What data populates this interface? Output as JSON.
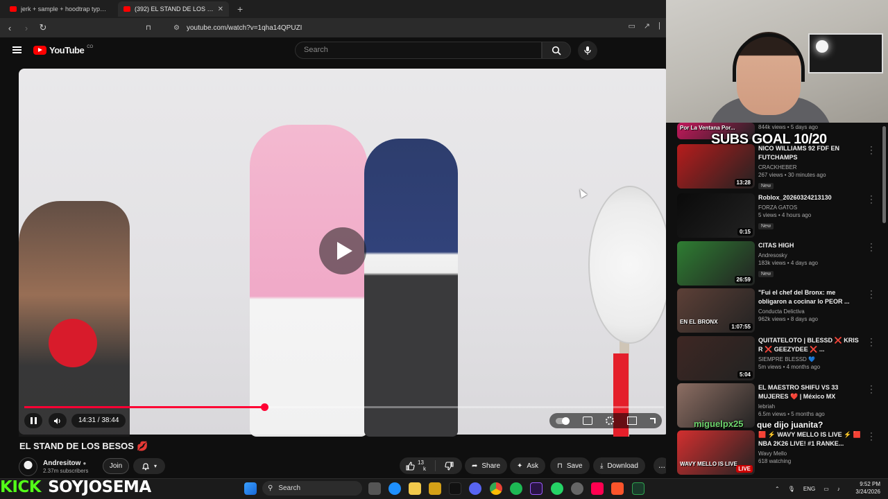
{
  "browser": {
    "tabs": [
      {
        "label": "jerk + sample + hoodtrap type beat",
        "active": false
      },
      {
        "label": "(392) EL STAND DE LOS BESOS",
        "active": true
      }
    ],
    "new_tab": "+",
    "url": "youtube.com/watch?v=1qha14QPUZI"
  },
  "youtube": {
    "logo_text": "YouTube",
    "country_code": "CO",
    "search_placeholder": "Search"
  },
  "player": {
    "time": "14:31 / 38:44",
    "progress_fraction": 0.375,
    "accent": "#ff0033"
  },
  "video": {
    "title": "EL STAND DE LOS BESOS",
    "title_emoji": "💋",
    "channel_name": "Andresitow",
    "subscribers": "2.37m subscribers",
    "join_label": "Join",
    "like_count": "13",
    "like_suffix": "k",
    "share_label": "Share",
    "ask_label": "Ask",
    "save_label": "Save",
    "download_label": "Download",
    "more_label": "..."
  },
  "sidebar": {
    "items": [
      {
        "title": "",
        "channel": "",
        "meta": "844k views • 5 days ago",
        "duration": "",
        "new": false,
        "thumb": "#c2185b",
        "thumb_text": "Por La Ventana Por..."
      },
      {
        "title": "NICO WILLIAMS 92 FDF EN FUTCHAMPS",
        "channel": "CRACKHEBER",
        "meta": "267 views • 30 minutes ago",
        "duration": "13:28",
        "new": true,
        "thumb": "#b71c1c"
      },
      {
        "title": "Roblox_20260324213130",
        "channel": "FORZA GATOS",
        "meta": "5 views • 4 hours ago",
        "duration": "0:15",
        "new": true,
        "thumb": "#0a0a0a"
      },
      {
        "title": "CITAS HIGH",
        "channel": "Andresosky",
        "meta": "183k views • 4 days ago",
        "duration": "26:59",
        "new": true,
        "thumb": "#2e7d32"
      },
      {
        "title": "\"Fui el chef del Bronx: me obligaron a cocinar lo PEOR ...",
        "channel": "Conducta Delictiva",
        "meta": "962k views • 8 days ago",
        "duration": "1:07:55",
        "new": false,
        "thumb": "#5d4037",
        "thumb_text": "EN EL BRONX"
      },
      {
        "title": "QUITATELOTO | BLESSD ❌ KRIS R ❌ GEEZYDEE ❌ ...",
        "channel": "SIEMPRE BLESSD 💙",
        "meta": "5m views • 4 months ago",
        "duration": "5:04",
        "new": false,
        "thumb": "#3e2723"
      },
      {
        "title": "EL MAESTRO SHIFU VS 33 MUJERES ❤️ | México MX",
        "channel": "lebriah",
        "meta": "6.5m views • 5 months ago",
        "duration": "",
        "new": false,
        "thumb": "#8d6e63"
      },
      {
        "title": "🟥 ⚡ WAVY MELLO IS LIVE ⚡ 🟥 NBA 2K26 LIVE! #1 RANKE...",
        "channel": "Wavy Mello",
        "meta": "618 watching",
        "duration": "LIVE",
        "new": false,
        "thumb": "#d32f2f",
        "thumb_text": "WAVY MELLO IS LIVE"
      }
    ],
    "new_badge": "New"
  },
  "overlay": {
    "subs_goal": "SUBS GOAL 10/20",
    "chat_user": "miguelpx25",
    "chat_message": "que dijo juanita?",
    "kick_label": "KICK",
    "streamer": "SOYJOSEMA"
  },
  "taskbar": {
    "search_label": "Search",
    "language": "ENG",
    "time": "9:52 PM",
    "date": "3/24/2026"
  }
}
